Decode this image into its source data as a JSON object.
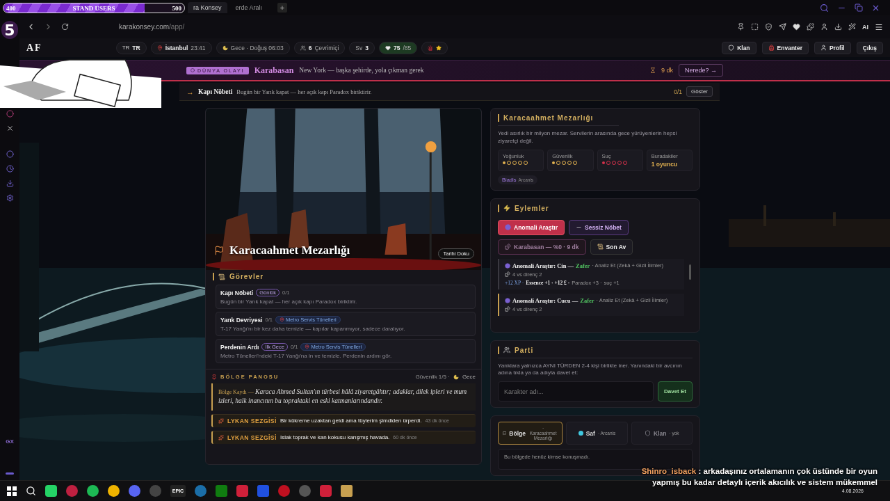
{
  "stream_goal": {
    "start": "400",
    "label": "STAND USERS",
    "end": "500",
    "level": 0.78
  },
  "browser": {
    "tabs": [
      {
        "label": "ra Konsey",
        "selected": true
      },
      {
        "label": "erde Aralı",
        "selected": false
      }
    ],
    "new_tab": "+",
    "url_host": "karakonsey.com",
    "url_path": "/app/",
    "sidebar_logo": "5",
    "sidebar_footer": "GX",
    "ai_label": "AI"
  },
  "header": {
    "logo": "AF",
    "lang_flag": "TR",
    "lang": "TR",
    "city": "İstanbul",
    "time": "23:41",
    "phase": "Gece · Doğuş 06:03",
    "online_count": "6",
    "online_label": "Çevrimiçi",
    "sv_label": "Sv",
    "sv_value": "3",
    "hp": "75",
    "hp_max": "/85",
    "nav": [
      {
        "label": "Klan",
        "kind": "shield"
      },
      {
        "label": "Envanter",
        "kind": "bag"
      },
      {
        "label": "Profil",
        "kind": "user"
      },
      {
        "label": "Çıkış",
        "kind": "none"
      }
    ]
  },
  "world_event": {
    "badge": "DÜNYA OLAYI",
    "title": "Karabasan",
    "text": "New York — başka şehirde, yola çıkman gerek",
    "timer": "9 dk",
    "button": "Nerede? →"
  },
  "quest_bar": {
    "arrow": "→",
    "title": "Kapı Nöbeti",
    "text": "Bugün bir Yarık kapat — her açık kapı Paradox biriktirir.",
    "progress": "0/1",
    "button": "Göster"
  },
  "location": {
    "title": "Karacaahmet Mezarlığı",
    "badge": "Tarihi Doku"
  },
  "quests": {
    "title": "Görevler",
    "items": [
      {
        "name": "Kapı Nöbeti",
        "tag": "Günlük",
        "progress": "0/1",
        "desc": "Bugün bir Yarık kapat — her açık kapı Paradox biriktirir."
      },
      {
        "name": "Yarık Devriyesi",
        "progress": "0/1",
        "place": "Metro Servis Tünelleri",
        "desc": "T-17 Yanğı'nı bir kez daha temizle — kapılar kapanmıyor, sadece daralıyor."
      },
      {
        "name": "Perdenin Ardı",
        "tag": "İlk Gece",
        "progress": "0/1",
        "place": "Metro Servis Tünelleri",
        "desc": "Metro Tünelleri'ndeki T-17 Yanğı'na in ve temizle. Perdenin ardını gör."
      }
    ]
  },
  "board": {
    "title": "BÖLGE PANOSU",
    "safety": "Güvenlik 1/5 ·",
    "phase": "Gece",
    "record_label": "Bölge Kaydı —",
    "record_text": "Karaca Ahmed Sultan'ın türbesi hâlâ ziyaretgâhtır; adaklar, dilek ipleri ve mum izleri, halk inancının bu topraktaki en eski katmanlarındandır.",
    "entries": [
      {
        "label": "LYKAN SEZGİSİ",
        "text": "Bir kükreme uzaktan geldi ama tüylerim şimdiden ürperdi.",
        "time": "43 dk önce"
      },
      {
        "label": "LYKAN SEZGİSİ",
        "text": "Islak toprak ve kan kokusu karışmış havada.",
        "time": "60 dk önce"
      }
    ]
  },
  "place_card": {
    "title": "Karacaahmet Mezarlığı",
    "desc": "Yedi asırlık bir milyon mezar. Servilerin arasında gece yürüyenlerin hepsi ziyaretçi değil.",
    "stats": [
      {
        "label": "Yoğunluk",
        "kind": "dots",
        "stars": 1,
        "color": "#e0b050"
      },
      {
        "label": "Güvenlik",
        "kind": "dots",
        "stars": 1,
        "color": "#e0b050"
      },
      {
        "label": "Suç",
        "kind": "dots",
        "stars": 1,
        "color": "#d0304a"
      },
      {
        "label": "Buradakiler",
        "kind": "text",
        "value": "1 oyuncu"
      }
    ],
    "tag": "Biadis",
    "tag_sub": "Arcanis"
  },
  "actions": {
    "title": "Eylemler",
    "buttons": [
      {
        "label": "Anomali Araştır",
        "kind": "danger"
      },
      {
        "label": "Sessiz Nöbet",
        "kind": "purple"
      },
      {
        "label": "Karabasan — %0 · 9 dk",
        "kind": "muted"
      },
      {
        "label": "Son Av",
        "kind": "dark"
      }
    ],
    "log": [
      {
        "title": "Anomali Araştır: Cin —",
        "result": "Zafer",
        "detail": "· Analiz Et (Zekâ + Gizli İlimler)",
        "roll": "4 vs direnç 2",
        "selected": false,
        "rewards": [
          {
            "text": "+12 XP ·",
            "kind": "xp"
          },
          {
            "text": "Essence +1 · +12 ₤ ·",
            "kind": "essence"
          },
          {
            "text": "Paradox +3 ·",
            "kind": "plain"
          },
          {
            "text": "suç +1",
            "kind": "crime"
          }
        ]
      },
      {
        "title": "Anomali Araştır: Cucu —",
        "result": "Zafer",
        "detail": "· Analiz Et (Zekâ + Gizli İlimler)",
        "roll": "4 vs direnç 2",
        "selected": true
      }
    ]
  },
  "party": {
    "title": "Parti",
    "desc": "Yarıklara yalnızca AYNI TÜRDEN 2-4 kişi birlikte iner. Yanındaki bir avcının adına tıkla ya da adıyla davet et:",
    "placeholder": "Karakter adı...",
    "button": "Davet Et"
  },
  "chat": {
    "tabs": [
      {
        "label": "Bölge",
        "sub": "· Karacaahmet Mezarlığı",
        "kind": "chat",
        "selected": true,
        "disabled": false
      },
      {
        "label": "Saf",
        "sub": "· Arcanis",
        "kind": "dot",
        "color": "#40c8e0",
        "selected": false,
        "disabled": false
      },
      {
        "label": "Klan",
        "sub": "· yok",
        "kind": "shield",
        "selected": false,
        "disabled": true
      }
    ],
    "empty": "Bu bölgede henüz kimse konuşmadı."
  },
  "stream_chat": {
    "user": "Shinro_isback",
    "message": ": arkadaşınız ortalamanın çok üstünde bir oyun yapmış bu kadar detaylı içerik akıcılık ve sistem mükemmel"
  },
  "taskbar": {
    "epic_label": "EPIC",
    "date": "4.08.2026"
  }
}
